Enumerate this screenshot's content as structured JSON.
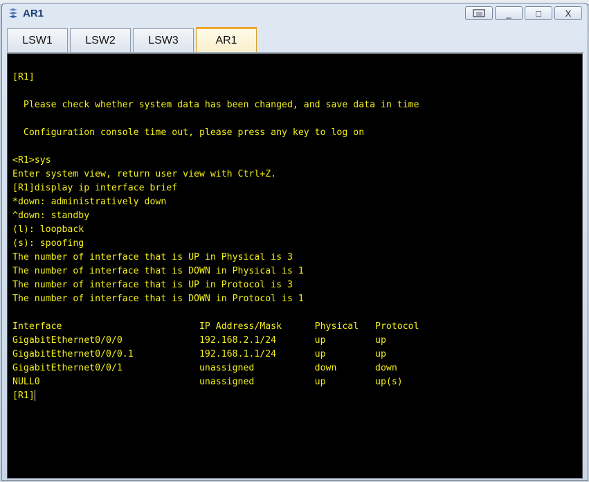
{
  "window": {
    "title": "AR1",
    "minimize": "_",
    "maximize": "□",
    "close": "X"
  },
  "tabs": [
    "LSW1",
    "LSW2",
    "LSW3",
    "AR1"
  ],
  "active_tab": "AR1",
  "console": {
    "lines": [
      "[R1]",
      "",
      "  Please check whether system data has been changed, and save data in time",
      "",
      "  Configuration console time out, please press any key to log on",
      "",
      "<R1>sys",
      "Enter system view, return user view with Ctrl+Z.",
      "[R1]display ip interface brief",
      "*down: administratively down",
      "^down: standby",
      "(l): loopback",
      "(s): spoofing",
      "The number of interface that is UP in Physical is 3",
      "The number of interface that is DOWN in Physical is 1",
      "The number of interface that is UP in Protocol is 3",
      "The number of interface that is DOWN in Protocol is 1",
      "",
      "Interface                         IP Address/Mask      Physical   Protocol",
      "GigabitEthernet0/0/0              192.168.2.1/24       up         up",
      "GigabitEthernet0/0/0.1            192.168.1.1/24       up         up",
      "GigabitEthernet0/0/1              unassigned           down       down",
      "NULL0                             unassigned           up         up(s)"
    ],
    "prompt": "[R1]"
  }
}
